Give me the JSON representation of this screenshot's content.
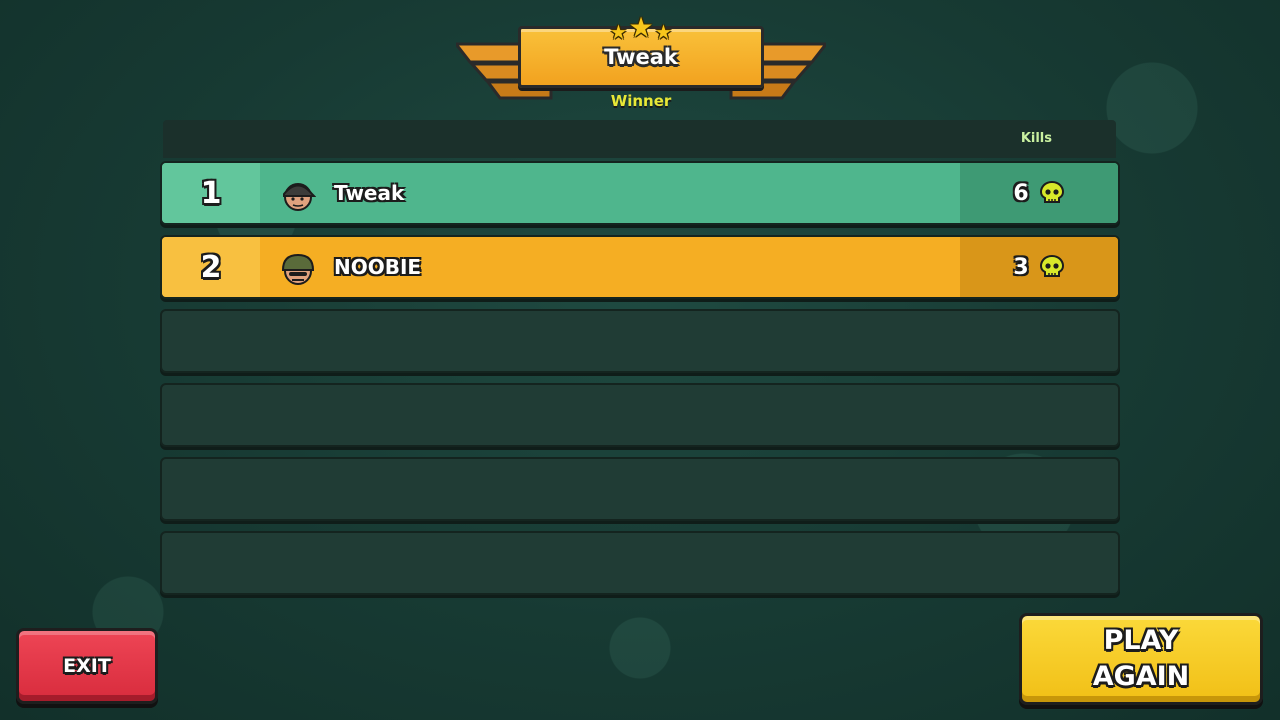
{
  "banner": {
    "winner_name": "Tweak",
    "subtitle": "Winner",
    "stars": 3
  },
  "table": {
    "kills_header": "Kills",
    "rows": [
      {
        "rank": "1",
        "name": "Tweak",
        "kills": "6",
        "avatar": "soldier-cap-avatar",
        "highlight_color": "#4fb68d"
      },
      {
        "rank": "2",
        "name": "NOOBIE",
        "kills": "3",
        "avatar": "soldier-helmet-avatar",
        "highlight_color": "#f5ae23"
      }
    ],
    "empty_rows": 4
  },
  "buttons": {
    "exit_label": "EXIT",
    "play_again_line1": "PLAY",
    "play_again_line2": "AGAIN"
  },
  "colors": {
    "background": "#173a33",
    "winner_text": "#e8e837",
    "exit_button": "#d82c3d",
    "play_button": "#f1bf16",
    "skull_icon": "#d8e82a"
  }
}
